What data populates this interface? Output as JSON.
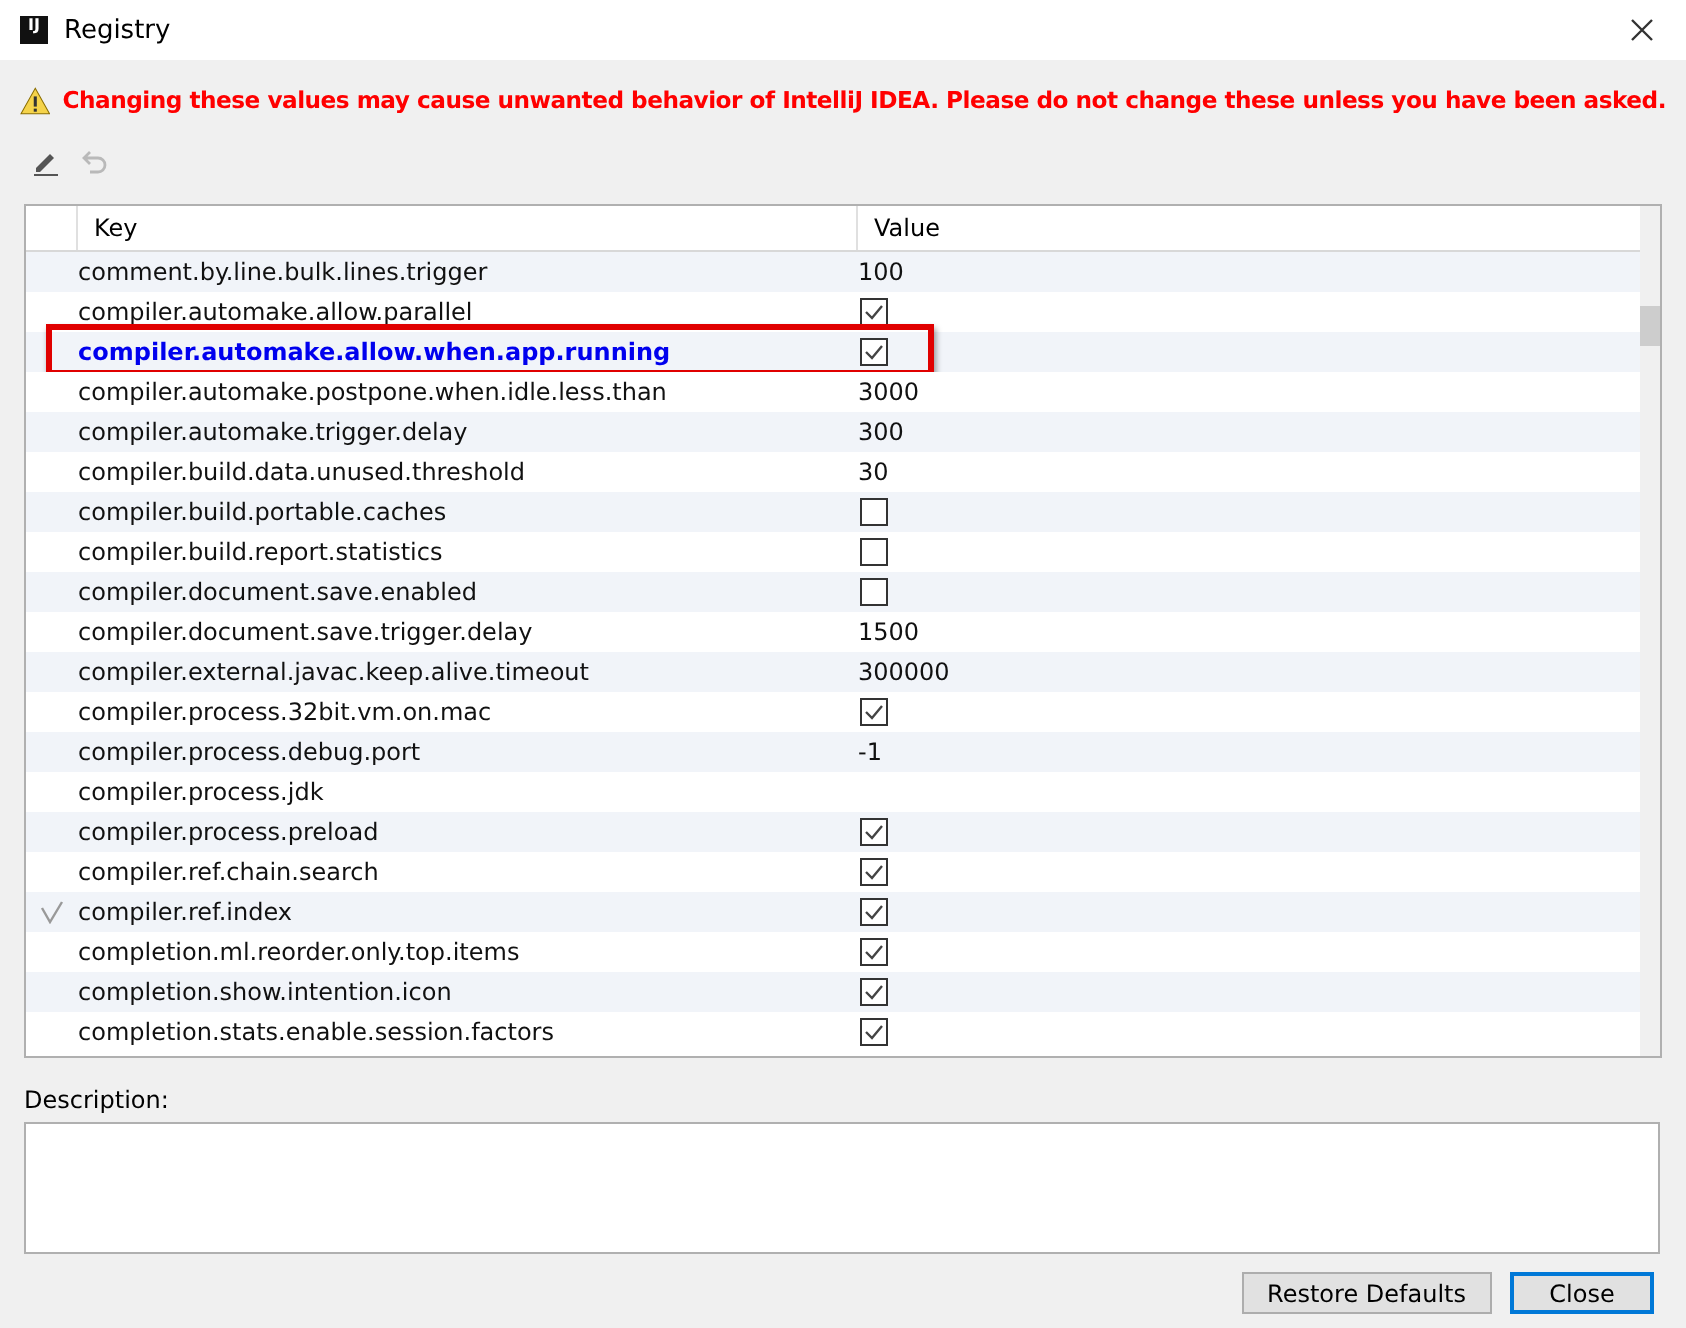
{
  "window": {
    "title": "Registry",
    "logo": "IJ"
  },
  "warning": "Changing these values may cause unwanted behavior of IntelliJ IDEA. Please do not change these unless you have been asked.",
  "toolbar": {
    "edit_disabled": false,
    "undo_disabled": true
  },
  "table": {
    "columns": [
      "Key",
      "Value"
    ],
    "rows": [
      {
        "key": "comment.by.line.bulk.lines.trigger",
        "kind": "text",
        "value": "100",
        "modified": false,
        "marked": false,
        "highlighted": false
      },
      {
        "key": "compiler.automake.allow.parallel",
        "kind": "bool",
        "checked": true,
        "modified": false,
        "marked": false,
        "highlighted": false
      },
      {
        "key": "compiler.automake.allow.when.app.running",
        "kind": "bool",
        "checked": true,
        "modified": true,
        "marked": false,
        "highlighted": true
      },
      {
        "key": "compiler.automake.postpone.when.idle.less.than",
        "kind": "text",
        "value": "3000",
        "modified": false,
        "marked": false,
        "highlighted": false
      },
      {
        "key": "compiler.automake.trigger.delay",
        "kind": "text",
        "value": "300",
        "modified": false,
        "marked": false,
        "highlighted": false
      },
      {
        "key": "compiler.build.data.unused.threshold",
        "kind": "text",
        "value": "30",
        "modified": false,
        "marked": false,
        "highlighted": false
      },
      {
        "key": "compiler.build.portable.caches",
        "kind": "bool",
        "checked": false,
        "modified": false,
        "marked": false,
        "highlighted": false
      },
      {
        "key": "compiler.build.report.statistics",
        "kind": "bool",
        "checked": false,
        "modified": false,
        "marked": false,
        "highlighted": false
      },
      {
        "key": "compiler.document.save.enabled",
        "kind": "bool",
        "checked": false,
        "modified": false,
        "marked": false,
        "highlighted": false
      },
      {
        "key": "compiler.document.save.trigger.delay",
        "kind": "text",
        "value": "1500",
        "modified": false,
        "marked": false,
        "highlighted": false
      },
      {
        "key": "compiler.external.javac.keep.alive.timeout",
        "kind": "text",
        "value": "300000",
        "modified": false,
        "marked": false,
        "highlighted": false
      },
      {
        "key": "compiler.process.32bit.vm.on.mac",
        "kind": "bool",
        "checked": true,
        "modified": false,
        "marked": false,
        "highlighted": false
      },
      {
        "key": "compiler.process.debug.port",
        "kind": "text",
        "value": "-1",
        "modified": false,
        "marked": false,
        "highlighted": false
      },
      {
        "key": "compiler.process.jdk",
        "kind": "text",
        "modified": false,
        "marked": false,
        "highlighted": false
      },
      {
        "key": "compiler.process.preload",
        "kind": "bool",
        "checked": true,
        "modified": false,
        "marked": false,
        "highlighted": false
      },
      {
        "key": "compiler.ref.chain.search",
        "kind": "bool",
        "checked": true,
        "modified": false,
        "marked": false,
        "highlighted": false
      },
      {
        "key": "compiler.ref.index",
        "kind": "bool",
        "checked": true,
        "modified": false,
        "marked": true,
        "highlighted": false
      },
      {
        "key": "completion.ml.reorder.only.top.items",
        "kind": "bool",
        "checked": true,
        "modified": false,
        "marked": false,
        "highlighted": false
      },
      {
        "key": "completion.show.intention.icon",
        "kind": "bool",
        "checked": true,
        "modified": false,
        "marked": false,
        "highlighted": false
      },
      {
        "key": "completion.stats.enable.session.factors",
        "kind": "bool",
        "checked": true,
        "modified": false,
        "marked": false,
        "highlighted": false
      }
    ]
  },
  "description": {
    "label": "Description:"
  },
  "buttons": [
    {
      "label": "Restore Defaults",
      "default": false
    },
    {
      "label": "Close",
      "default": true
    }
  ]
}
